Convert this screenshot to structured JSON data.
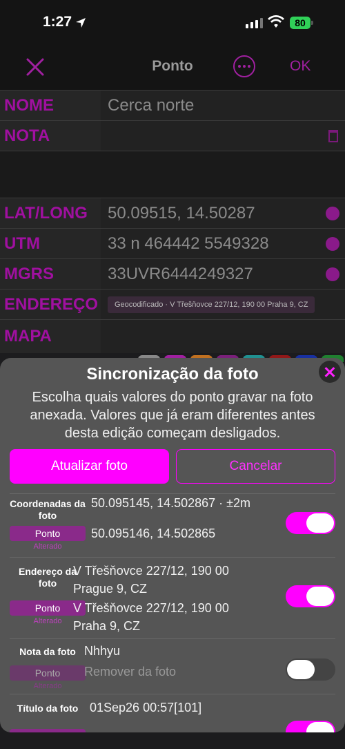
{
  "status": {
    "time": "1:27",
    "battery": "80"
  },
  "nav": {
    "title": "Ponto",
    "ok": "OK"
  },
  "fields": [
    {
      "label": "NOME",
      "value": "Cerca norte"
    },
    {
      "label": "NOTA",
      "value": ""
    },
    {
      "label": "LAT/LONG",
      "value": "50.09515, 14.50287"
    },
    {
      "label": "UTM",
      "value": "33 n 464442 5549328"
    },
    {
      "label": "MGRS",
      "value": "33UVR6444249327"
    },
    {
      "label": "ENDEREÇO",
      "value": "Geocodificado · V Třešňovce 227/12, 190 00 Praha 9, CZ"
    },
    {
      "label": "MAPA",
      "value": ""
    }
  ],
  "sheet": {
    "title": "Sincronização da foto",
    "description": "Escolha quais valores do ponto gravar na foto anexada. Valores que já eram diferentes antes desta edição começam desligados.",
    "update_label": "Atualizar foto",
    "cancel_label": "Cancelar",
    "items": [
      {
        "label": "Coordenadas da foto",
        "photo_value": "50.095145, 14.502867 · ±2m",
        "chip": "Ponto",
        "changed": "Alterado",
        "point_value": "50.095146, 14.502865",
        "on": true
      },
      {
        "label": "Endereço da foto",
        "photo_value": "V Třešňovce 227/12, 190 00 Prague 9, CZ",
        "chip": "Ponto",
        "changed": "Alterado",
        "point_value": "V Třešňovce 227/12, 190 00 Praha 9, CZ",
        "on": true
      },
      {
        "label": "Nota da foto",
        "photo_value": "Nhhyu",
        "chip": "Ponto",
        "changed": "Alterado",
        "point_value": "Remover da foto",
        "on": false
      },
      {
        "label": "Título da foto",
        "photo_value": "01Sep26 00:57[101]",
        "on": true
      }
    ]
  },
  "colors": {
    "accent": "#ff00ff",
    "label": "#a010a0",
    "sheet": "#555555"
  }
}
